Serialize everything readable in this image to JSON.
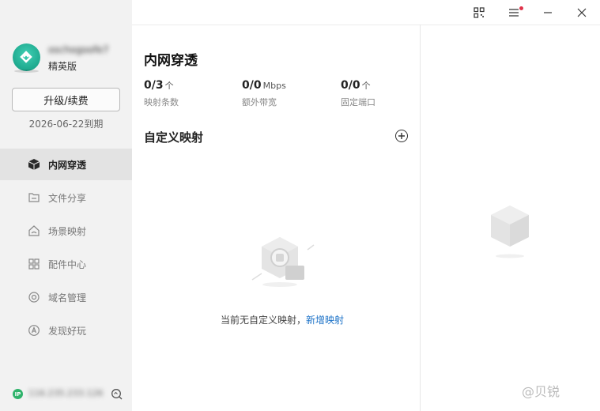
{
  "sidebar": {
    "username": "oschogoofe7",
    "edition": "精英版",
    "upgrade_label": "升级/续费",
    "expiry": "2026-06-22到期",
    "items": [
      {
        "label": "内网穿透",
        "icon": "cube-icon",
        "active": true
      },
      {
        "label": "文件分享",
        "icon": "folder-icon",
        "active": false
      },
      {
        "label": "场景映射",
        "icon": "home-icon",
        "active": false
      },
      {
        "label": "配件中心",
        "icon": "grid-icon",
        "active": false
      },
      {
        "label": "域名管理",
        "icon": "globe-icon",
        "active": false
      },
      {
        "label": "发现好玩",
        "icon": "compass-icon",
        "active": false
      }
    ],
    "ip_badge": "IP",
    "ip_text": "116.235.233.126"
  },
  "main": {
    "title": "内网穿透",
    "stats": [
      {
        "value": "0/3",
        "unit": "个",
        "caption": "映射条数"
      },
      {
        "value": "0/0",
        "unit": "Mbps",
        "caption": "额外带宽"
      },
      {
        "value": "0/0",
        "unit": "个",
        "caption": "固定端口"
      }
    ],
    "section_title": "自定义映射",
    "empty_text": "当前无自定义映射，",
    "empty_link": "新增映射"
  },
  "titlebar": {
    "icons": [
      "qr-code-icon",
      "menu-icon",
      "minimize-icon",
      "close-icon"
    ]
  },
  "watermark": "@贝锐"
}
